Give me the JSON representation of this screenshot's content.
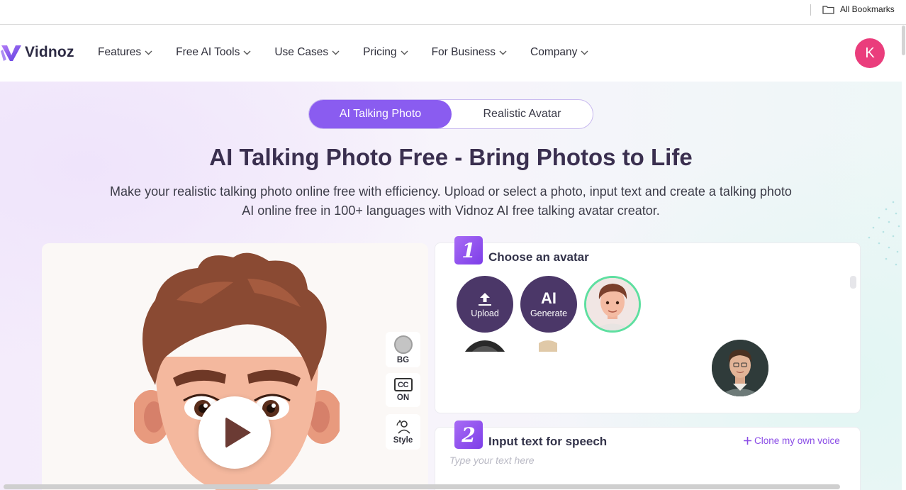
{
  "bookmarks_bar": {
    "all_bookmarks": "All Bookmarks"
  },
  "nav": {
    "brand": "Vidnoz",
    "items": [
      "Features",
      "Free AI Tools",
      "Use Cases",
      "Pricing",
      "For Business",
      "Company"
    ],
    "user_initial": "K"
  },
  "hero": {
    "tabs": {
      "active": "AI Talking Photo",
      "inactive": "Realistic Avatar"
    },
    "title": "AI Talking Photo Free - Bring Photos to Life",
    "subtitle_line1": "Make your realistic talking photo online free with efficiency. Upload or select a photo, input text and create a talking photo",
    "subtitle_line2": "AI online free in 100+ languages with Vidnoz AI free talking avatar creator."
  },
  "preview_tools": {
    "bg": "BG",
    "cc_icon": "CC",
    "cc": "ON",
    "style": "Style"
  },
  "step1": {
    "number": "1",
    "title": "Choose an avatar",
    "upload": "Upload",
    "generate_icon": "AI",
    "generate": "Generate"
  },
  "step2": {
    "number": "2",
    "title": "Input text for speech",
    "clone": "Clone my own voice",
    "placeholder": "Type your text here"
  },
  "colors": {
    "accent": "#8a5cf0",
    "avatar_user": "#ea3d7c",
    "avatar_button": "#4b3768",
    "selected_ring": "#5edfa0"
  }
}
